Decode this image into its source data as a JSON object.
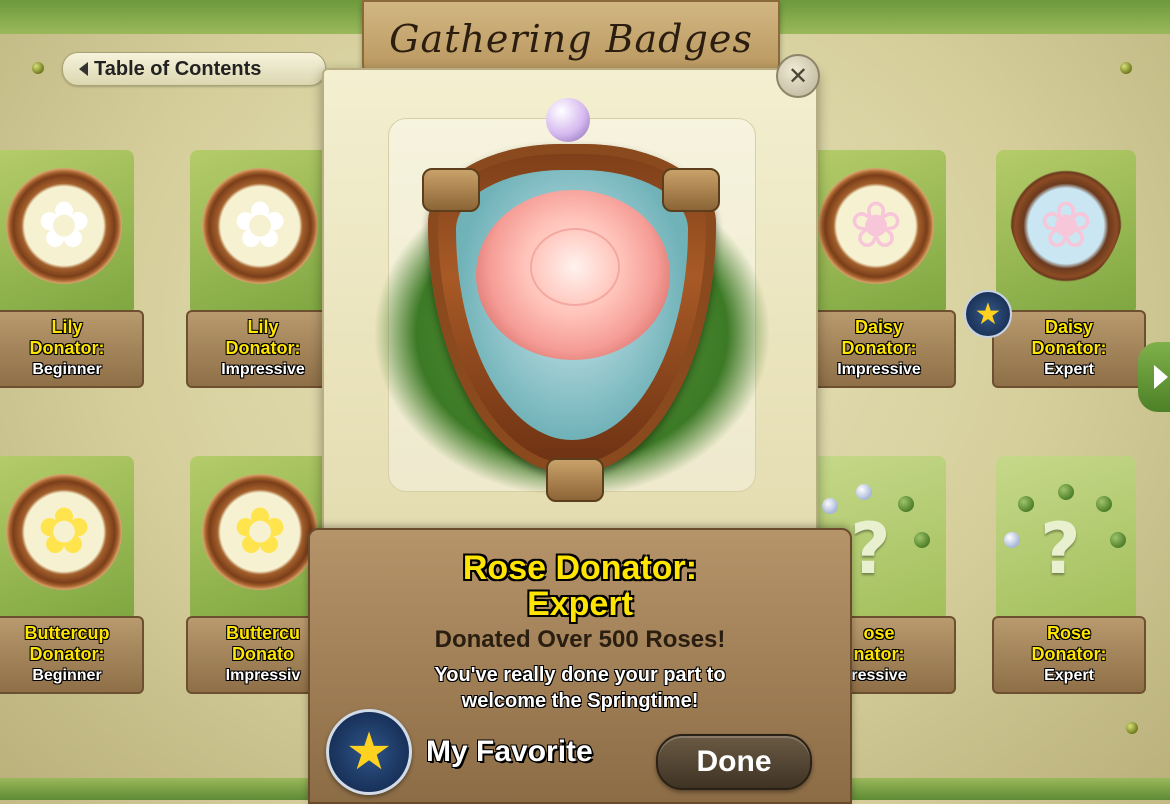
{
  "header": {
    "title": "Gathering Badges",
    "toc_label": "Table of Contents"
  },
  "tiles": [
    {
      "name": "Lily",
      "line2": "Donator:",
      "level": "Beginner",
      "icon": "lily-icon"
    },
    {
      "name": "Lily",
      "line2": "Donator:",
      "level": "Impressive",
      "icon": "lily-icon"
    },
    {
      "name": "Daisy",
      "line2": "Donator:",
      "level": "Impressive",
      "icon": "daisy-icon"
    },
    {
      "name": "Daisy",
      "line2": "Donator:",
      "level": "Expert",
      "icon": "daisy-icon",
      "favorite": true
    },
    {
      "name": "Buttercup",
      "line2": "Donator:",
      "level": "Beginner",
      "icon": "buttercup-icon"
    },
    {
      "name": "Buttercu",
      "line2": "Donato",
      "level": "Impressiv",
      "icon": "buttercup-icon"
    },
    {
      "name": "ose",
      "line2": "nator:",
      "level": "ressive",
      "icon": "question-mark-icon",
      "locked": true
    },
    {
      "name": "Rose",
      "line2": "Donator:",
      "level": "Expert",
      "icon": "question-mark-icon",
      "locked": true
    }
  ],
  "detail": {
    "title_line1": "Rose Donator:",
    "title_line2": "Expert",
    "subtitle": "Donated Over 500 Roses!",
    "desc_line1": "You've really done your part to",
    "desc_line2": "welcome the Springtime!",
    "favorite_label": "My Favorite",
    "done_label": "Done",
    "close_glyph": "✕",
    "badge_icon": "rose-badge-icon"
  },
  "colors": {
    "title_yellow": "#ffe500",
    "plank_brown": "#8e6f47",
    "leaf_green": "#7ea640",
    "star_gold": "#ffd21f"
  }
}
